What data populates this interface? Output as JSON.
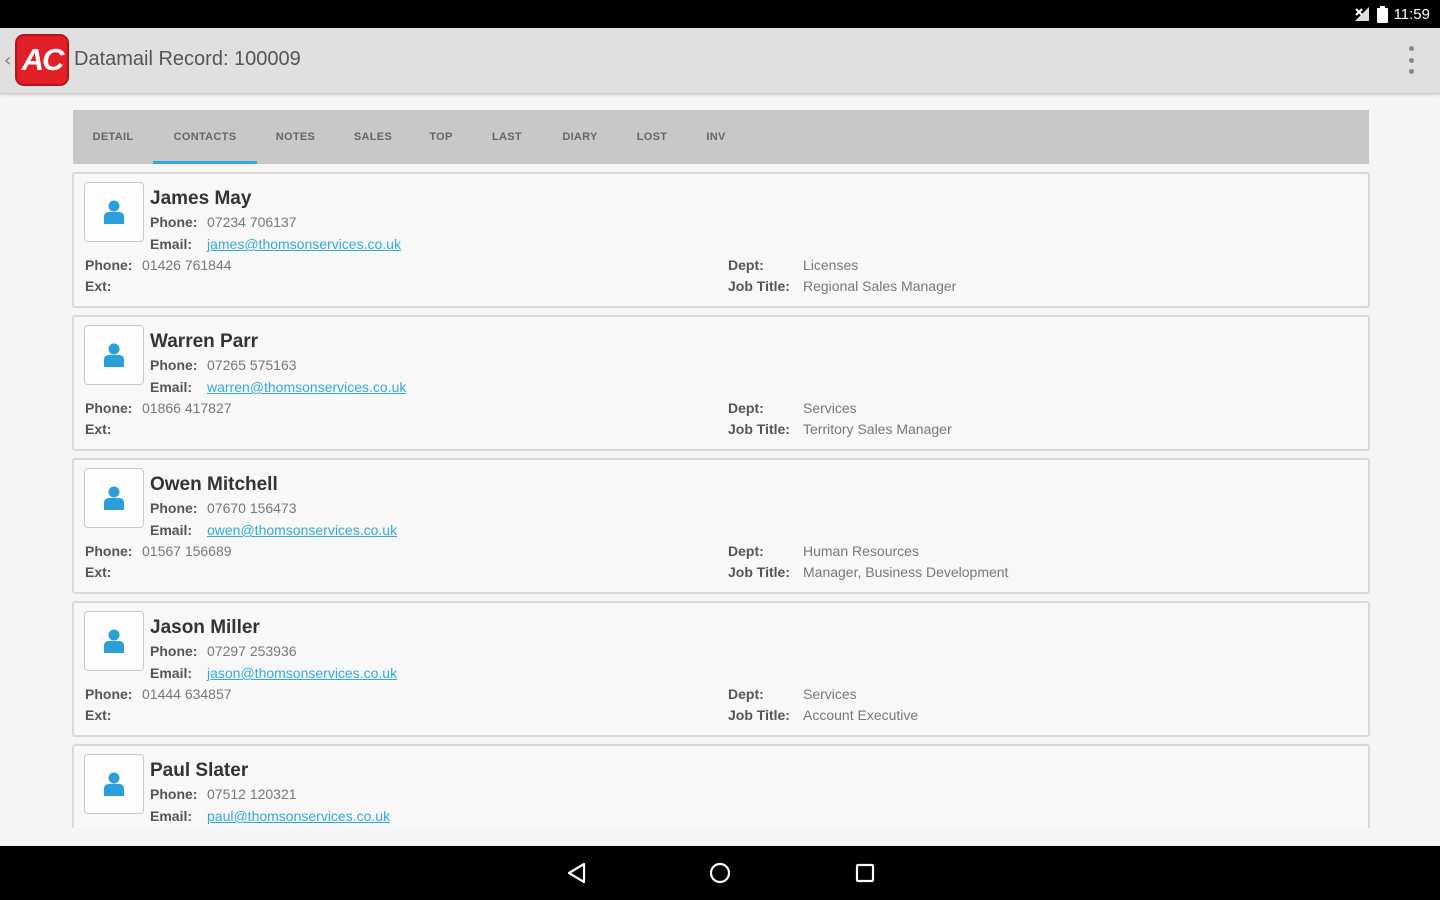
{
  "status_bar": {
    "time": "11:59"
  },
  "app_bar": {
    "back_glyph": "‹",
    "logo_text": "AC",
    "title": "Datamail Record: 100009",
    "menu_icon": "overflow-menu-icon"
  },
  "tabs": [
    {
      "label": "DETAIL",
      "active": false
    },
    {
      "label": "CONTACTS",
      "active": true
    },
    {
      "label": "NOTES",
      "active": false
    },
    {
      "label": "SALES",
      "active": false
    },
    {
      "label": "TOP",
      "active": false
    },
    {
      "label": "LAST",
      "active": false
    },
    {
      "label": "DIARY",
      "active": false
    },
    {
      "label": "LOST",
      "active": false
    },
    {
      "label": "INV",
      "active": false
    }
  ],
  "labels": {
    "phone": "Phone:",
    "email": "Email:",
    "ext": "Ext:",
    "dept": "Dept:",
    "job_title": "Job Title:"
  },
  "contacts": [
    {
      "name": "James May",
      "mobile": "07234 706137",
      "email": "james@thomsonservices.co.uk",
      "phone": "01426 761844",
      "ext": "",
      "dept": "Licenses",
      "job_title": "Regional Sales Manager"
    },
    {
      "name": "Warren Parr",
      "mobile": "07265 575163",
      "email": "warren@thomsonservices.co.uk",
      "phone": "01866 417827",
      "ext": "",
      "dept": "Services",
      "job_title": "Territory Sales Manager"
    },
    {
      "name": "Owen Mitchell",
      "mobile": "07670 156473",
      "email": "owen@thomsonservices.co.uk",
      "phone": "01567 156689",
      "ext": "",
      "dept": "Human Resources",
      "job_title": "Manager, Business Development"
    },
    {
      "name": "Jason Miller",
      "mobile": "07297 253936",
      "email": "jason@thomsonservices.co.uk",
      "phone": "01444 634857",
      "ext": "",
      "dept": "Services",
      "job_title": "Account Executive"
    },
    {
      "name": "Paul Slater",
      "mobile": "07512 120321",
      "email": "paul@thomsonservices.co.uk",
      "phone": "",
      "ext": "",
      "dept": "",
      "job_title": ""
    }
  ],
  "colors": {
    "accent": "#33a8dc",
    "logo_red": "#e21f26",
    "avatar_icon": "#2b9fd9"
  },
  "nav_bar": {
    "icons": [
      "back-triangle-icon",
      "home-circle-icon",
      "recents-square-icon"
    ]
  }
}
